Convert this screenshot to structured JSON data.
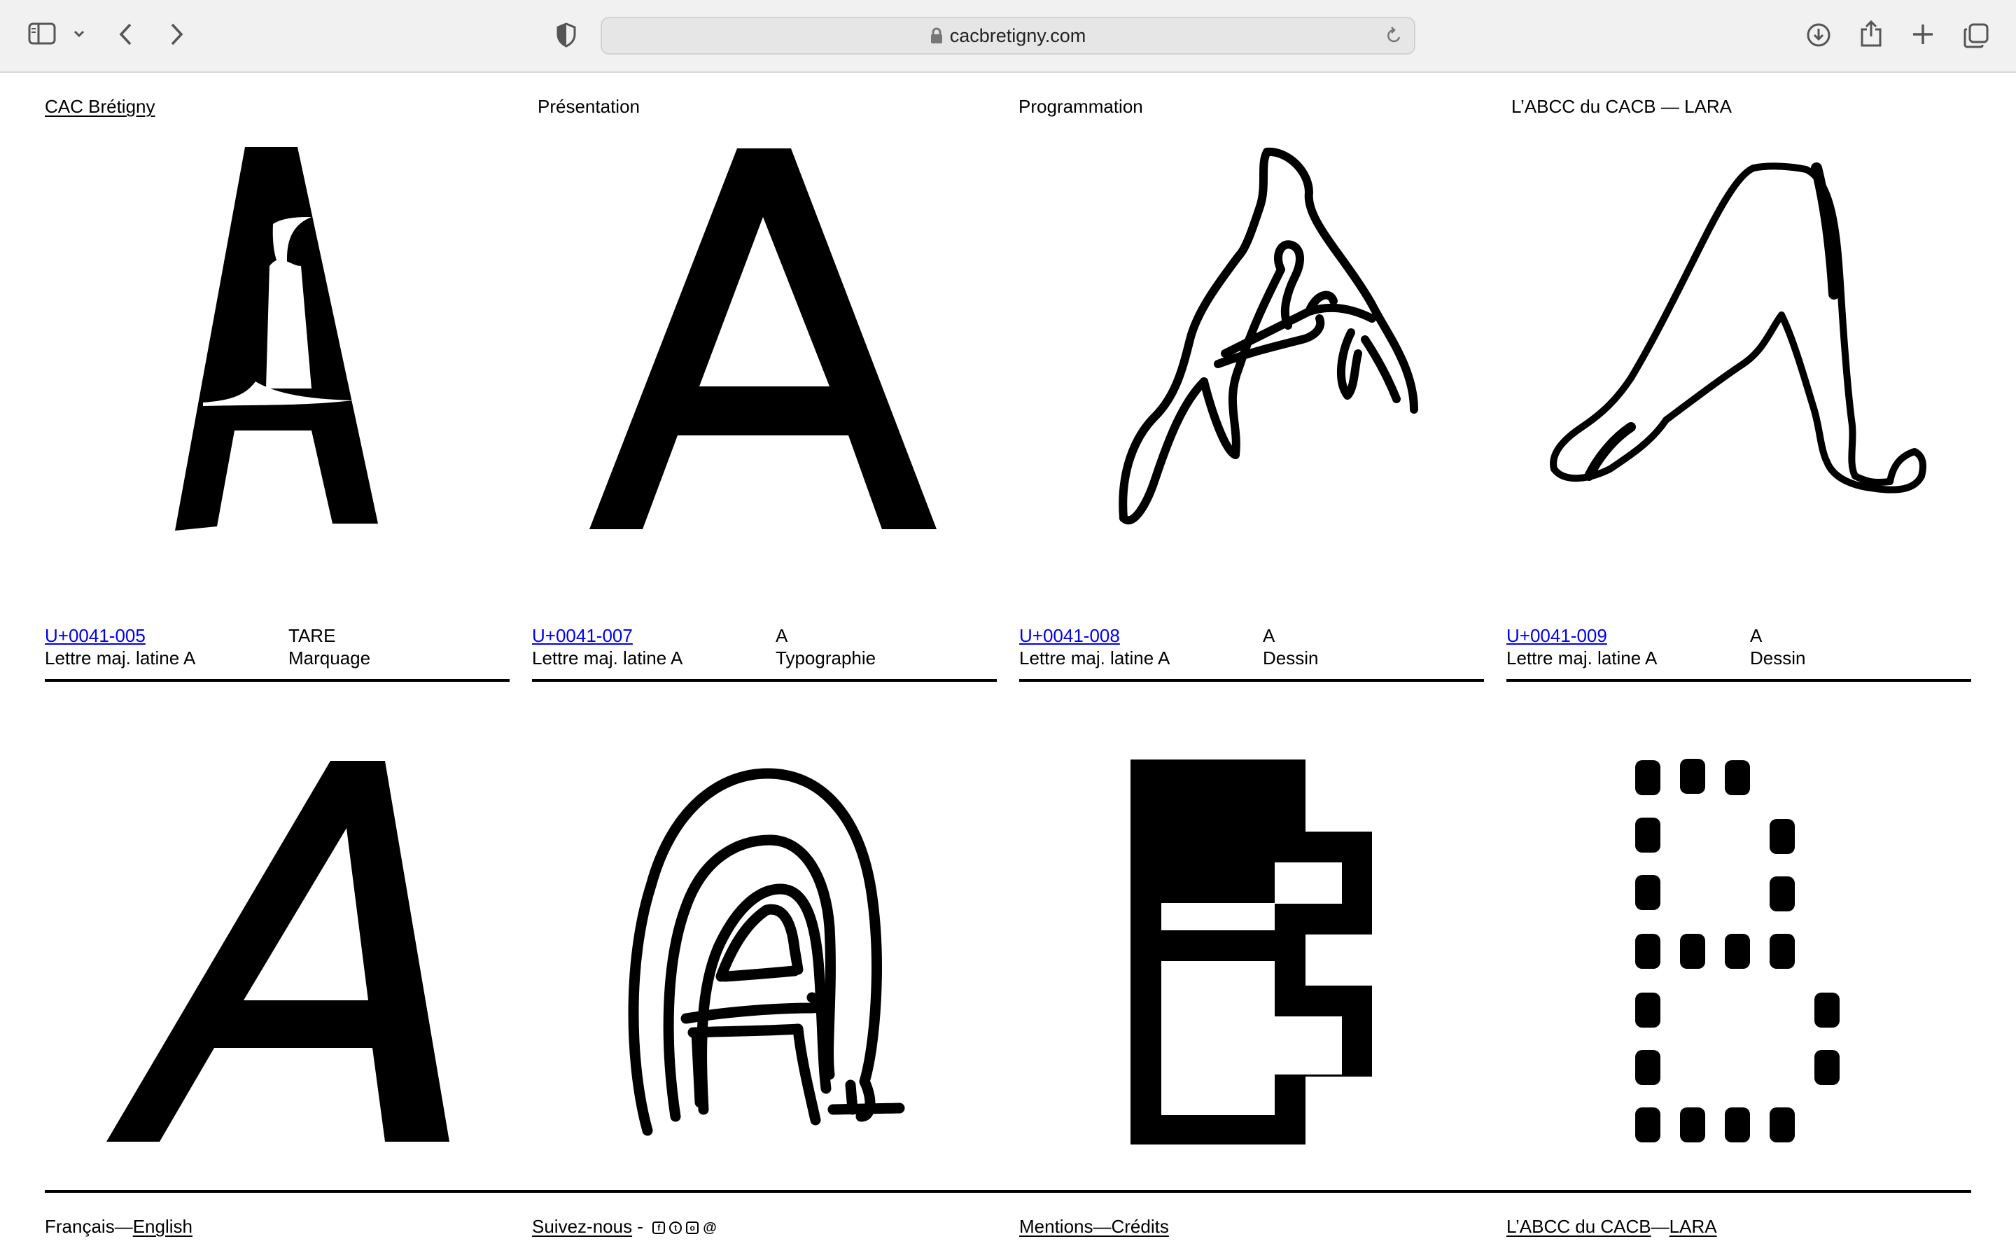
{
  "browser": {
    "url": "cacbretigny.com",
    "icons": [
      "sidebar-icon",
      "chevron-down-icon",
      "back-icon",
      "forward-icon",
      "privacy-shield-icon",
      "lock-icon",
      "reload-icon",
      "download-icon",
      "share-icon",
      "new-tab-icon",
      "tabs-overview-icon"
    ]
  },
  "nav": {
    "home": "CAC Brétigny",
    "presentation": "Présentation",
    "programmation": "Programmation",
    "abcc": "L’ABCC du CACB — LARA"
  },
  "cards": [
    {
      "code": "U+0041-005",
      "name": "Lettre maj. latine A",
      "glyph": "TARE",
      "category": "Marquage"
    },
    {
      "code": "U+0041-007",
      "name": "Lettre maj. latine A",
      "glyph": "A",
      "category": "Typographie"
    },
    {
      "code": "U+0041-008",
      "name": "Lettre maj. latine A",
      "glyph": "A",
      "category": "Dessin"
    },
    {
      "code": "U+0041-009",
      "name": "Lettre maj. latine A",
      "glyph": "A",
      "category": "Dessin"
    }
  ],
  "footer": {
    "lang_fr": "Français",
    "lang_sep": "—",
    "lang_en": "English",
    "follow": "Suivez-nous",
    "follow_sep": " - ",
    "social_icons": [
      "facebook-icon",
      "twitter-icon",
      "instagram-icon",
      "at-icon"
    ],
    "mentions": "Mentions",
    "mentions_sep": "—",
    "credits": "Crédits",
    "abcc": "L’ABCC du CACB",
    "abcc_sep": "—",
    "lara": "LARA"
  }
}
